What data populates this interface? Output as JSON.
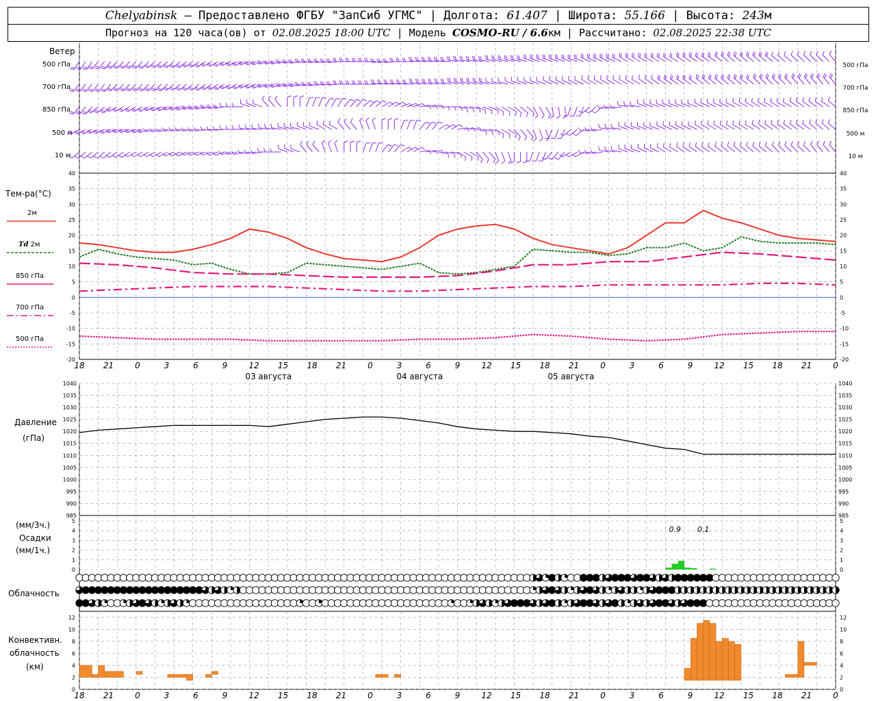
{
  "header": {
    "city": "Chelyabinsk",
    "provider": " — Предоставлено ФГБУ \"ЗапСиб УГМС\" | Долгота: ",
    "lon": "61.407",
    "lat_label": " | Широта: ",
    "lat": "55.166",
    "alt_label": " | Высота: ",
    "alt": "243",
    "alt_unit": "м",
    "forecast_prefix": "Прогноз на 120 часа(ов) от ",
    "forecast_time": "02.08.2025 18:00 UTC",
    "model_prefix": " | Модель ",
    "model": "COSMO-RU / 6.6",
    "model_unit": "км",
    "calc_prefix": " | Рассчитано: ",
    "calc_time": "02.08.2025 22:38 UTC"
  },
  "labels": {
    "wind": "Ветер",
    "wind_levels": [
      "500 гПа",
      "700 гПа",
      "850 гПа",
      "500 м",
      "10 м"
    ],
    "temp": "Тем-ра(°C)",
    "legend_2m": "2м",
    "legend_td": "Td",
    "legend_td2": " 2м",
    "legend_850": "850 гПа",
    "legend_700": "700 гПа",
    "legend_500": "500 гПа",
    "pressure": "Давление",
    "pressure_unit": "(гПа)",
    "precip_top": "(мм/3ч.)",
    "precip": "Осадки",
    "precip_unit": "(мм/1ч.)",
    "cloud": "Облачность",
    "conv1": "Конвективн.",
    "conv2": "облачность",
    "conv3": "(км)"
  },
  "time_axis": {
    "tick_labels": [
      "18",
      "21",
      "0",
      "3",
      "6",
      "9",
      "12",
      "15",
      "18",
      "21",
      "0",
      "3",
      "6",
      "9",
      "12",
      "15",
      "18",
      "21",
      "0",
      "3",
      "6",
      "9",
      "12",
      "15",
      "18",
      "21",
      "0"
    ],
    "dates": [
      "03 августа",
      "04 августа",
      "05 августа"
    ]
  },
  "colors": {
    "wind": "#8a2be2",
    "t2m": "#e8392e",
    "td2m": "#1f7a1f",
    "t850": "#e0197d",
    "pressure": "#000000",
    "precip": "#22cc22",
    "conv": "#f08a2e"
  },
  "chart_data": [
    {
      "type": "line",
      "title": "Тем-ра(°C)",
      "x_unit": "hours since 02.08.2025 18:00 UTC",
      "ylim": [
        -20,
        40
      ],
      "series": [
        {
          "name": "2м",
          "x": [
            0,
            3,
            6,
            9,
            12,
            15,
            18,
            21,
            24,
            27,
            30,
            33,
            36,
            39,
            42,
            45,
            48,
            51,
            54,
            57,
            60,
            63,
            66,
            69,
            72,
            75,
            78,
            81,
            84,
            87,
            90,
            93,
            96,
            99,
            102,
            105,
            108,
            111,
            114,
            117,
            120
          ],
          "values": [
            17.5,
            17,
            16,
            15,
            14.5,
            14.5,
            15.5,
            17,
            19,
            22,
            21,
            19,
            16,
            14,
            12.5,
            12,
            11.5,
            13,
            16,
            20,
            22,
            23,
            23.5,
            22,
            19,
            17,
            16,
            15,
            14,
            16,
            20,
            24,
            24,
            28,
            25.5,
            24,
            22,
            20,
            19,
            18.5,
            18
          ]
        },
        {
          "name": "Td 2м",
          "x": [
            0,
            3,
            6,
            9,
            12,
            15,
            18,
            21,
            24,
            27,
            30,
            33,
            36,
            39,
            42,
            45,
            48,
            51,
            54,
            57,
            60,
            63,
            66,
            69,
            72,
            75,
            78,
            81,
            84,
            87,
            90,
            93,
            96,
            99,
            102,
            105,
            108,
            111,
            114,
            117,
            120
          ],
          "values": [
            13,
            15.5,
            14,
            13,
            12.5,
            12,
            10.5,
            11,
            9,
            7.5,
            7.5,
            8,
            11,
            10.5,
            10,
            9.5,
            9,
            10,
            11,
            8,
            7.5,
            8,
            9,
            10,
            15.5,
            15,
            14.5,
            14.5,
            13.5,
            14,
            16,
            16,
            17.5,
            15,
            16,
            19.5,
            18,
            17.5,
            17.5,
            17.5,
            17
          ]
        },
        {
          "name": "850 гПа",
          "x": [
            0,
            6,
            12,
            18,
            24,
            30,
            36,
            42,
            48,
            54,
            60,
            66,
            72,
            78,
            84,
            90,
            96,
            102,
            108,
            114,
            120
          ],
          "values": [
            11,
            10.5,
            9.5,
            8,
            7.5,
            7.5,
            7,
            6.5,
            6.5,
            6.5,
            7,
            8.5,
            10.5,
            10.5,
            11.5,
            11.5,
            13,
            14.5,
            14,
            13,
            12
          ]
        },
        {
          "name": "700 гПа",
          "x": [
            0,
            6,
            12,
            18,
            24,
            30,
            36,
            42,
            48,
            54,
            60,
            66,
            72,
            78,
            84,
            90,
            96,
            102,
            108,
            114,
            120
          ],
          "values": [
            2,
            2.5,
            3,
            3.5,
            3.5,
            3.5,
            3,
            2.5,
            2,
            2,
            2.5,
            3,
            3.5,
            3.5,
            4,
            4,
            4,
            4,
            4.5,
            4.5,
            4
          ]
        },
        {
          "name": "500 гПа",
          "x": [
            0,
            6,
            12,
            18,
            24,
            30,
            36,
            42,
            48,
            54,
            60,
            66,
            72,
            78,
            84,
            90,
            96,
            102,
            108,
            114,
            120
          ],
          "values": [
            -12.5,
            -13,
            -13.5,
            -13.5,
            -13.5,
            -14,
            -14,
            -14,
            -14,
            -13.5,
            -13.5,
            -13,
            -12,
            -12.5,
            -13.5,
            -14,
            -13.5,
            -12,
            -11.5,
            -11,
            -11
          ]
        }
      ]
    },
    {
      "type": "line",
      "title": "Давление",
      "ylabel": "(гПа)",
      "ylim": [
        985,
        1040
      ],
      "series": [
        {
          "name": "Давление",
          "x": [
            0,
            3,
            6,
            9,
            12,
            15,
            18,
            21,
            24,
            27,
            30,
            33,
            36,
            39,
            42,
            45,
            48,
            51,
            54,
            57,
            60,
            63,
            66,
            69,
            72,
            75,
            78,
            81,
            84,
            87,
            90,
            93,
            96,
            99,
            102,
            105,
            108,
            111,
            114,
            117,
            120
          ],
          "values": [
            1019.5,
            1020.5,
            1021,
            1021.5,
            1022,
            1022.5,
            1022.5,
            1022.5,
            1022.5,
            1022.5,
            1022,
            1023,
            1024,
            1025,
            1025.5,
            1026,
            1026,
            1025.5,
            1024.5,
            1023.5,
            1022,
            1021,
            1020.5,
            1020,
            1020,
            1019.5,
            1019,
            1018,
            1017.5,
            1016,
            1014.5,
            1013,
            1012.5,
            1010.5,
            1010.5,
            1010.5,
            1010.5,
            1010.5,
            1010.5,
            1010.5,
            1010.5
          ]
        }
      ]
    },
    {
      "type": "bar",
      "title": "Осадки",
      "ylim": [
        0,
        5
      ],
      "annotations": [
        "0.9",
        "0.1"
      ],
      "series": [
        {
          "name": "Осадки",
          "x": [
            93,
            94,
            95,
            96,
            97,
            100
          ],
          "values": [
            0.2,
            0.6,
            0.9,
            0.2,
            0.15,
            0.1
          ]
        }
      ]
    },
    {
      "type": "bar",
      "title": "Конвективн. облачность (км)",
      "ylim": [
        0,
        13
      ],
      "series": [
        {
          "name": "Конвективн. облачность",
          "segments": [
            {
              "x0": 0,
              "x1": 2,
              "bottom": 2,
              "top": 4
            },
            {
              "x0": 2,
              "x1": 3,
              "bottom": 2,
              "top": 2.5
            },
            {
              "x0": 3,
              "x1": 4,
              "bottom": 2,
              "top": 4
            },
            {
              "x0": 4,
              "x1": 7,
              "bottom": 2,
              "top": 3
            },
            {
              "x0": 9,
              "x1": 10,
              "bottom": 2.5,
              "top": 3
            },
            {
              "x0": 14,
              "x1": 17,
              "bottom": 2,
              "top": 2.5
            },
            {
              "x0": 17,
              "x1": 18,
              "bottom": 1.5,
              "top": 2.5
            },
            {
              "x0": 20,
              "x1": 21,
              "bottom": 2,
              "top": 2.5
            },
            {
              "x0": 21,
              "x1": 22,
              "bottom": 2.5,
              "top": 3
            },
            {
              "x0": 47,
              "x1": 49,
              "bottom": 2,
              "top": 2.5
            },
            {
              "x0": 50,
              "x1": 51,
              "bottom": 2,
              "top": 2.5
            },
            {
              "x0": 96,
              "x1": 97,
              "bottom": 1.5,
              "top": 3.5
            },
            {
              "x0": 97,
              "x1": 98,
              "bottom": 1.5,
              "top": 8.5
            },
            {
              "x0": 98,
              "x1": 99,
              "bottom": 1.5,
              "top": 11
            },
            {
              "x0": 99,
              "x1": 100,
              "bottom": 1.5,
              "top": 11.5
            },
            {
              "x0": 100,
              "x1": 101,
              "bottom": 1.5,
              "top": 11
            },
            {
              "x0": 101,
              "x1": 102,
              "bottom": 1.5,
              "top": 8
            },
            {
              "x0": 102,
              "x1": 103,
              "bottom": 1.5,
              "top": 8.5
            },
            {
              "x0": 103,
              "x1": 104,
              "bottom": 1.5,
              "top": 8
            },
            {
              "x0": 104,
              "x1": 105,
              "bottom": 1.5,
              "top": 7.5
            },
            {
              "x0": 112,
              "x1": 114,
              "bottom": 2,
              "top": 2.5
            },
            {
              "x0": 114,
              "x1": 115,
              "bottom": 2,
              "top": 8
            },
            {
              "x0": 115,
              "x1": 117,
              "bottom": 4,
              "top": 4.5
            }
          ]
        }
      ]
    }
  ]
}
